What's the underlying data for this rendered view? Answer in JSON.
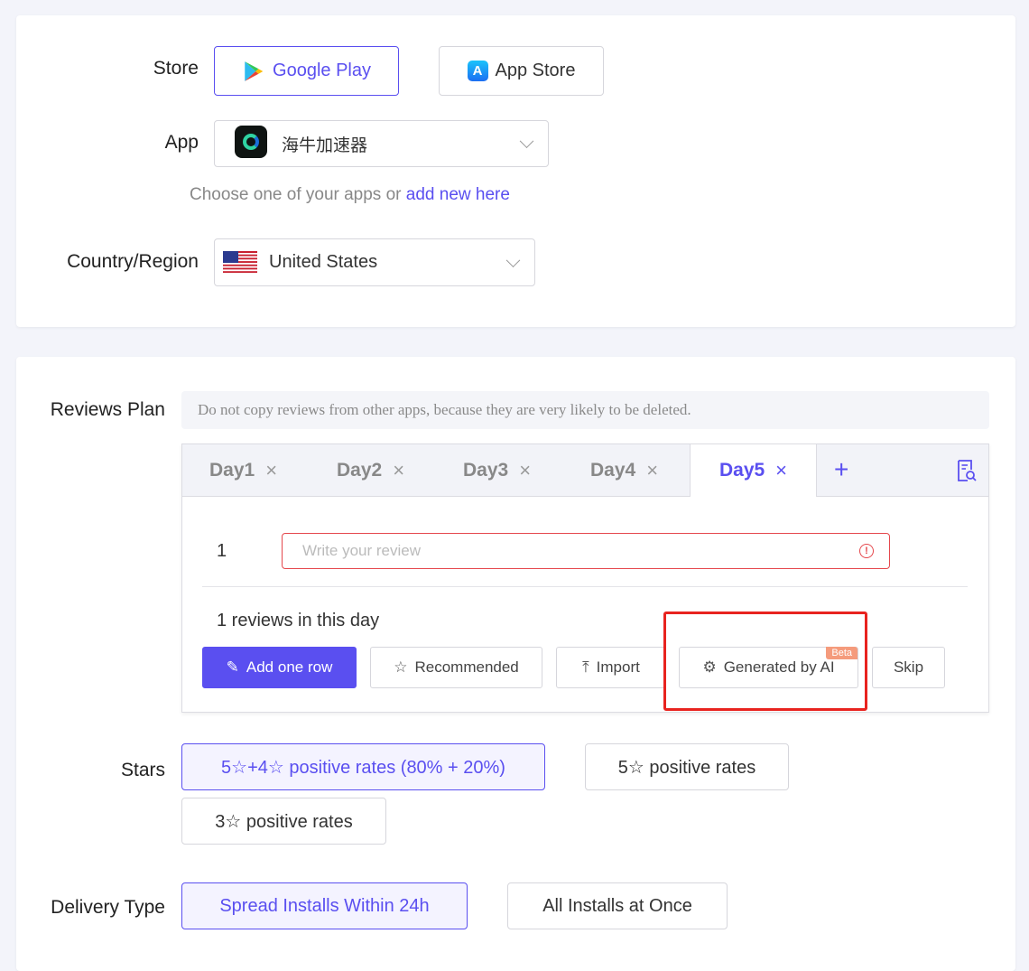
{
  "store": {
    "label": "Store",
    "google_play": "Google Play",
    "app_store": "App Store"
  },
  "app": {
    "label": "App",
    "selected": "海牛加速器",
    "hint_prefix": "Choose one of your apps or",
    "hint_link": "add new here"
  },
  "country": {
    "label": "Country/Region",
    "selected": "United States"
  },
  "reviews": {
    "label": "Reviews Plan",
    "notice": "Do not copy reviews from other apps, because they are very likely to be deleted.",
    "tabs": [
      {
        "label": "Day1",
        "close": "×"
      },
      {
        "label": "Day2",
        "close": "×"
      },
      {
        "label": "Day3",
        "close": "×"
      },
      {
        "label": "Day4",
        "close": "×"
      },
      {
        "label": "Day5",
        "close": "×"
      }
    ],
    "add_tab": "+",
    "row_number": "1",
    "placeholder": "Write your review",
    "count_text": "1 reviews in this day",
    "buttons": {
      "add_row": "Add one row",
      "recommended": "Recommended",
      "import": "Import",
      "generated": "Generated by AI",
      "beta": "Beta",
      "skip": "Skip"
    }
  },
  "stars": {
    "label": "Stars",
    "options": [
      "5☆+4☆ positive rates (80% + 20%)",
      "5☆ positive rates",
      "3☆ positive rates"
    ]
  },
  "delivery": {
    "label": "Delivery Type",
    "options": [
      "Spread Installs Within 24h",
      "All Installs at Once"
    ]
  },
  "colors": {
    "accent": "#5a4ff0",
    "error": "#e5484d",
    "highlight": "#e8231f"
  }
}
